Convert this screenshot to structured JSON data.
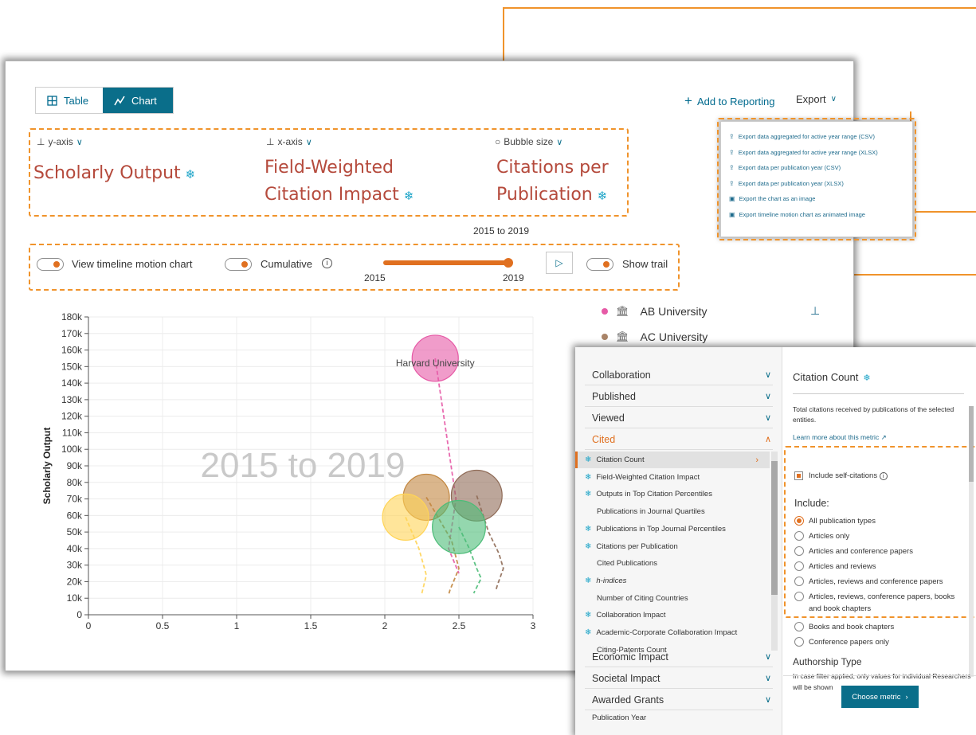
{
  "view_toggle": {
    "table_label": "Table",
    "chart_label": "Chart"
  },
  "top_links": {
    "add_reporting": "Add to Reporting",
    "export": "Export"
  },
  "axes": {
    "y": {
      "label": "y-axis",
      "metric": "Scholarly Output"
    },
    "x": {
      "label": "x-axis",
      "metric_line1": "Field-Weighted",
      "metric_line2": "Citation Impact"
    },
    "bubble": {
      "label": "Bubble size",
      "metric_line1": "Citations per",
      "metric_line2": "Publication"
    }
  },
  "controls": {
    "timeline_label": "View timeline motion chart",
    "cumulative_label": "Cumulative",
    "range_label": "2015 to 2019",
    "range_start": "2015",
    "range_end": "2019",
    "trail_label": "Show trail"
  },
  "legend": [
    {
      "name": "AB University",
      "color": "#e65aa6"
    },
    {
      "name": "AC University",
      "color": "#a98468"
    }
  ],
  "chart_data": {
    "type": "scatter",
    "watermark": "2015 to 2019",
    "ylabel": "Scholarly Output",
    "xlim": [
      0,
      3
    ],
    "ylim": [
      0,
      180000
    ],
    "x_ticks": [
      "0",
      "0.5",
      "1",
      "1.5",
      "2",
      "2.5",
      "3"
    ],
    "y_ticks": [
      "0",
      "10k",
      "20k",
      "30k",
      "40k",
      "50k",
      "60k",
      "70k",
      "80k",
      "90k",
      "100k",
      "110k",
      "120k",
      "130k",
      "140k",
      "150k",
      "160k",
      "170k",
      "180k"
    ],
    "series": [
      {
        "name": "Harvard University",
        "color": "#e65aa6",
        "x": 2.34,
        "y": 155000,
        "size": 1.0,
        "trail": [
          [
            2.34,
            155000
          ],
          [
            2.48,
            70000
          ],
          [
            2.43,
            40000
          ],
          [
            2.5,
            25000
          ]
        ]
      },
      {
        "name": "",
        "color": "#c2863f",
        "x": 2.28,
        "y": 71000,
        "size": 1.0,
        "trail": [
          [
            2.28,
            71000
          ],
          [
            2.45,
            45000
          ],
          [
            2.5,
            28000
          ],
          [
            2.44,
            15000
          ],
          [
            2.43,
            12000
          ]
        ]
      },
      {
        "name": "",
        "color": "#8f6b57",
        "x": 2.62,
        "y": 72000,
        "size": 1.1,
        "trail": [
          [
            2.62,
            72000
          ],
          [
            2.7,
            50000
          ],
          [
            2.77,
            37000
          ],
          [
            2.8,
            28000
          ],
          [
            2.76,
            18000
          ],
          [
            2.75,
            15000
          ]
        ]
      },
      {
        "name": "",
        "color": "#ffd456",
        "x": 2.14,
        "y": 59000,
        "size": 1.0,
        "trail": [
          [
            2.14,
            59000
          ],
          [
            2.23,
            40000
          ],
          [
            2.28,
            24000
          ],
          [
            2.25,
            13000
          ]
        ]
      },
      {
        "name": "",
        "color": "#4cbc78",
        "x": 2.5,
        "y": 53000,
        "size": 1.15,
        "trail": [
          [
            2.5,
            53000
          ],
          [
            2.57,
            40000
          ],
          [
            2.62,
            28000
          ],
          [
            2.65,
            22000
          ],
          [
            2.6,
            13000
          ]
        ]
      }
    ],
    "labels": [
      {
        "text": "Harvard University",
        "x": 2.34,
        "y": 152000
      }
    ]
  },
  "export_menu": [
    {
      "icon": "upload-icon",
      "label": "Export data aggregated for active year range (CSV)"
    },
    {
      "icon": "upload-icon",
      "label": "Export data aggregated for active year range (XLSX)"
    },
    {
      "icon": "upload-icon",
      "label": "Export data per publication year (CSV)"
    },
    {
      "icon": "upload-icon",
      "label": "Export data per publication year (XLSX)"
    },
    {
      "icon": "image-icon",
      "label": "Export the chart as an image"
    },
    {
      "icon": "image-icon",
      "label": "Export timeline motion chart as animated image"
    }
  ],
  "metric_panel": {
    "categories_top": [
      "Collaboration",
      "Published",
      "Viewed",
      "Cited"
    ],
    "cited_metrics": [
      {
        "label": "Citation Count",
        "snowball": true
      },
      {
        "label": "Field-Weighted Citation Impact",
        "snowball": true
      },
      {
        "label": "Outputs in Top Citation Percentiles",
        "snowball": true
      },
      {
        "label": "Publications in Journal Quartiles",
        "snowball": false
      },
      {
        "label": "Publications in Top Journal Percentiles",
        "snowball": true
      },
      {
        "label": "Citations per Publication",
        "snowball": true
      },
      {
        "label": "Cited Publications",
        "snowball": false
      },
      {
        "label": "h-indices",
        "snowball": true
      },
      {
        "label": "Number of Citing Countries",
        "snowball": false
      },
      {
        "label": "Collaboration Impact",
        "snowball": true
      },
      {
        "label": "Academic-Corporate Collaboration Impact",
        "snowball": true
      },
      {
        "label": "Citing-Patents Count",
        "snowball": false
      }
    ],
    "categories_bottom": [
      "Economic Impact",
      "Societal Impact",
      "Awarded Grants",
      "Publication Year"
    ],
    "detail": {
      "title": "Citation Count",
      "description": "Total citations received by publications of the selected entities.",
      "link": "Learn more about this metric",
      "checkbox_label": "Include self-citations",
      "include_label": "Include:",
      "options": [
        "All publication types",
        "Articles only",
        "Articles and conference papers",
        "Articles and reviews",
        "Articles, reviews and conference papers",
        "Articles, reviews, conference papers, books and book chapters",
        "Books and book chapters",
        "Conference papers only"
      ],
      "authorship_title": "Authorship Type",
      "authorship_desc": "In case filter applied, only values for individual Researchers will be shown",
      "choose_button": "Choose metric"
    }
  }
}
